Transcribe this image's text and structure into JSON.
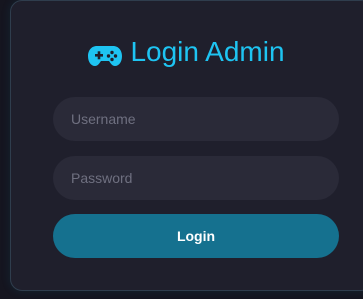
{
  "header": {
    "title": "Login Admin",
    "icon": "gamepad-icon",
    "accent_color": "#1ec4f2"
  },
  "form": {
    "username_placeholder": "Username",
    "password_placeholder": "Password",
    "login_label": "Login",
    "button_color": "#15718f"
  }
}
